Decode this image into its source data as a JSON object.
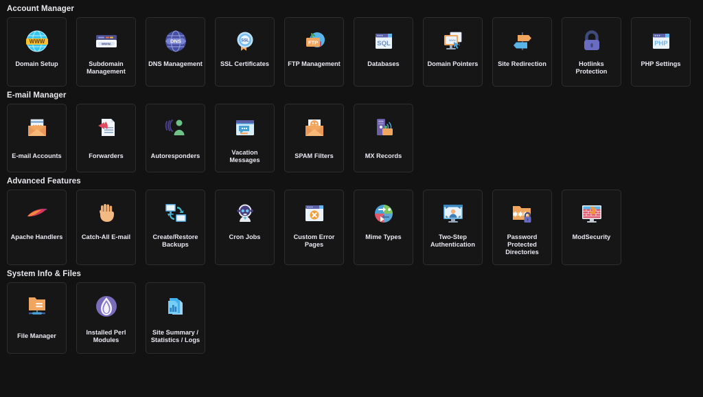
{
  "theme": {
    "background": "#121212",
    "card_bg": "#161616",
    "card_border": "#2e2e2e",
    "heading_color": "#e9e9ef",
    "label_color": "#eceaf4"
  },
  "sections": [
    {
      "title": "Account Manager",
      "items": [
        {
          "label": "Domain Setup",
          "icon": "globe-www-icon"
        },
        {
          "label": "Subdomain Management",
          "icon": "browser-window-www-icon"
        },
        {
          "label": "DNS Management",
          "icon": "dns-globe-icon"
        },
        {
          "label": "SSL Certificates",
          "icon": "ssl-badge-icon"
        },
        {
          "label": "FTP Management",
          "icon": "ftp-folder-icon"
        },
        {
          "label": "Databases",
          "icon": "sql-window-icon"
        },
        {
          "label": "Domain Pointers",
          "icon": "monitor-pointer-icon"
        },
        {
          "label": "Site Redirection",
          "icon": "signpost-arrows-icon"
        },
        {
          "label": "Hotlinks Protection",
          "icon": "padlock-icon"
        },
        {
          "label": "PHP Settings",
          "icon": "php-window-icon"
        }
      ]
    },
    {
      "title": "E-mail Manager",
      "items": [
        {
          "label": "E-mail Accounts",
          "icon": "open-envelope-letter-icon"
        },
        {
          "label": "Forwarders",
          "icon": "document-forward-arrow-icon"
        },
        {
          "label": "Autoresponders",
          "icon": "person-broadcast-icon"
        },
        {
          "label": "Vacation Messages",
          "icon": "chat-window-icon"
        },
        {
          "label": "SPAM Filters",
          "icon": "envelope-smiley-icon"
        },
        {
          "label": "MX Records",
          "icon": "server-signal-folder-icon"
        }
      ]
    },
    {
      "title": "Advanced Features",
      "items": [
        {
          "label": "Apache Handlers",
          "icon": "apache-feather-icon"
        },
        {
          "label": "Catch-All E-mail",
          "icon": "open-hand-icon"
        },
        {
          "label": "Create/Restore Backups",
          "icon": "two-monitors-sync-icon"
        },
        {
          "label": "Cron Jobs",
          "icon": "robot-icon"
        },
        {
          "label": "Custom Error Pages",
          "icon": "browser-error-x-icon"
        },
        {
          "label": "Mime Types",
          "icon": "pie-arrows-icon"
        },
        {
          "label": "Two-Step Authentication",
          "icon": "monitor-face-scan-icon"
        },
        {
          "label": "Password Protected Directories",
          "icon": "folder-asterisk-lock-icon"
        },
        {
          "label": "ModSecurity",
          "icon": "monitor-firewall-icon"
        }
      ]
    },
    {
      "title": "System Info & Files",
      "items": [
        {
          "label": "File Manager",
          "icon": "folder-network-icon"
        },
        {
          "label": "Installed Perl Modules",
          "icon": "perl-onion-icon"
        },
        {
          "label": "Site Summary / Statistics / Logs",
          "icon": "chart-documents-icon"
        }
      ]
    }
  ]
}
